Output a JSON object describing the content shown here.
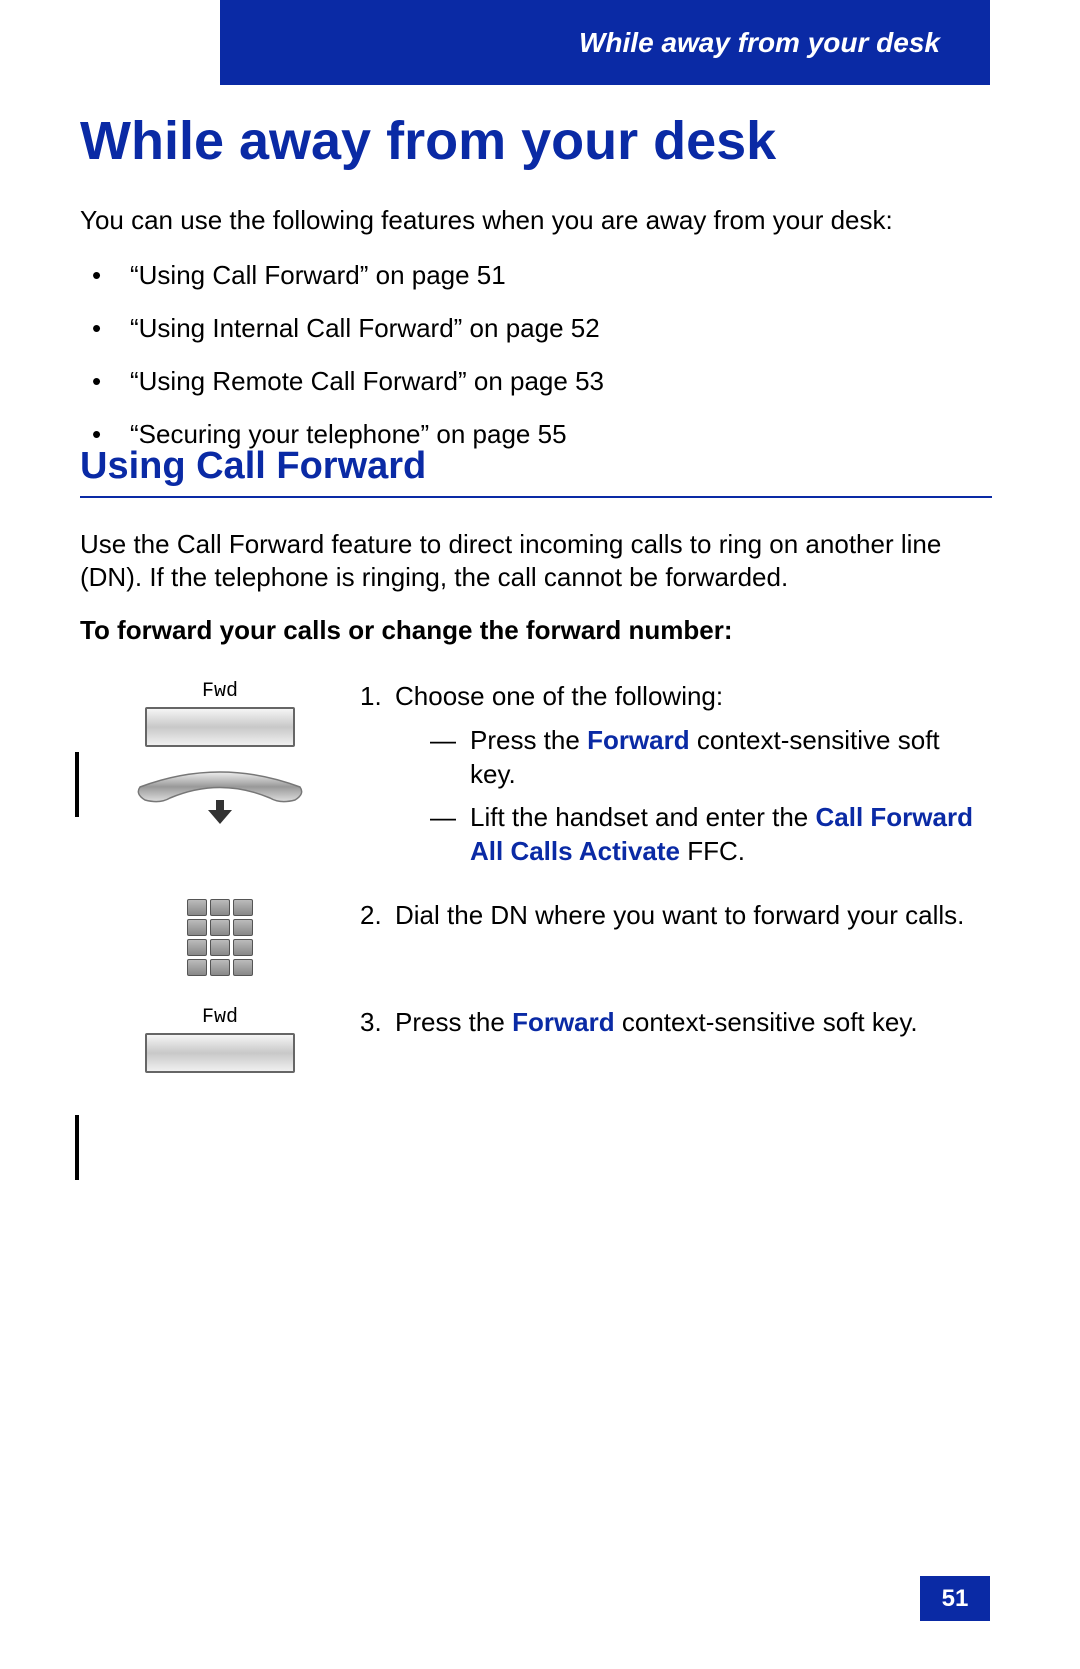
{
  "header": {
    "section": "While away from your desk"
  },
  "h1": "While away from your desk",
  "intro": "You can use the following features when you are away from your desk:",
  "bullets": [
    "“Using Call Forward” on page 51",
    "“Using Internal Call Forward” on page 52",
    "“Using Remote Call Forward” on page 53",
    "“Securing your telephone” on page 55"
  ],
  "h2": "Using Call Forward",
  "desc": "Use the Call Forward feature to direct incoming calls to ring on another line (DN). If the telephone is ringing, the call cannot be forwarded.",
  "sub_bold": "To forward your calls or change the forward number:",
  "fwd_label": "Fwd",
  "steps": {
    "s1": {
      "num": "1.",
      "lead": "Choose one of the following:",
      "a_pre": "Press the ",
      "a_kw": "Forward",
      "a_post": " context-sensitive soft key.",
      "b_pre": "Lift the handset and enter the ",
      "b_kw": "Call Forward All Calls Activate",
      "b_post": " FFC."
    },
    "s2": {
      "num": "2.",
      "text": "Dial the DN where you want to forward your calls."
    },
    "s3": {
      "num": "3.",
      "pre": "Press the ",
      "kw": "Forward",
      "post": " context-sensitive soft key."
    }
  },
  "page_number": "51"
}
